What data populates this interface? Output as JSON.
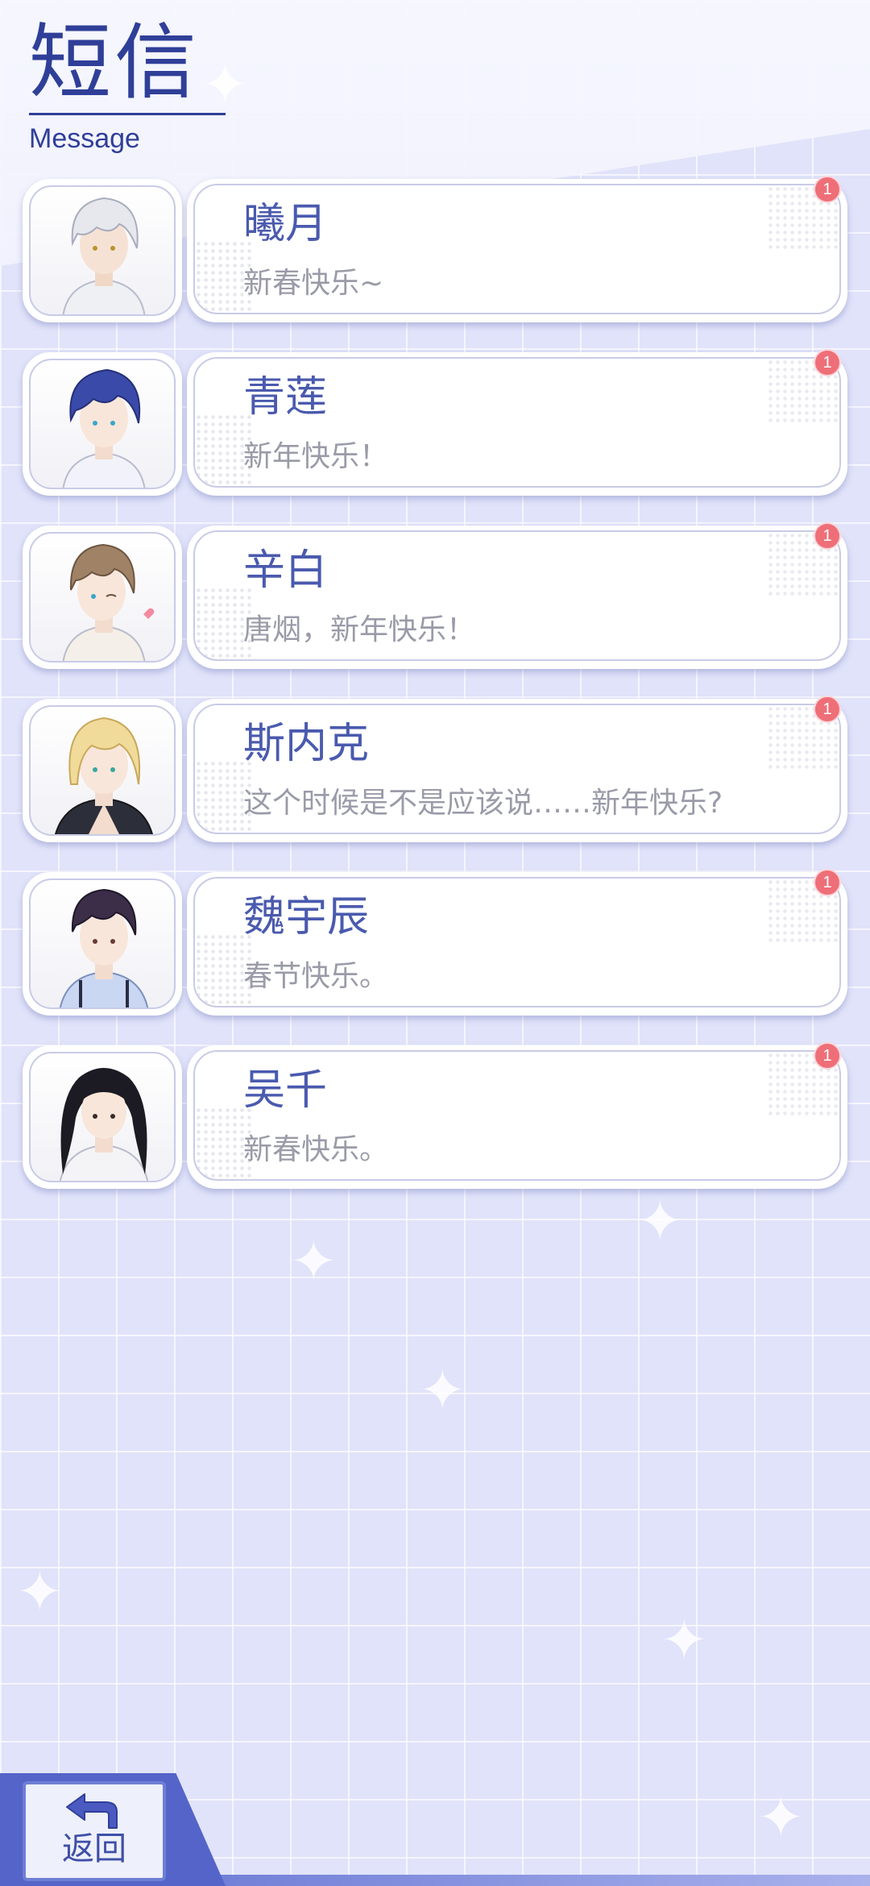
{
  "header": {
    "title": "短信",
    "subtitle": "Message"
  },
  "contacts": [
    {
      "name": "曦月",
      "message": "新春快乐~",
      "badge": "1",
      "avatar": "avatar-silver-hair"
    },
    {
      "name": "青莲",
      "message": "新年快乐！",
      "badge": "1",
      "avatar": "avatar-blue-hair"
    },
    {
      "name": "辛白",
      "message": "唐烟，新年快乐！",
      "badge": "1",
      "avatar": "avatar-brown-hair"
    },
    {
      "name": "斯内克",
      "message": "这个时候是不是应该说……新年快乐?",
      "badge": "1",
      "avatar": "avatar-blond-hair"
    },
    {
      "name": "魏宇辰",
      "message": "春节快乐。",
      "badge": "1",
      "avatar": "avatar-dark-hair"
    },
    {
      "name": "吴千",
      "message": "新春快乐。",
      "badge": "1",
      "avatar": "avatar-long-black-hair"
    }
  ],
  "footer": {
    "back_label": "返回",
    "back_icon": "back-arrow-icon"
  },
  "colors": {
    "accent": "#2f3f98",
    "name_text": "#4a5aae",
    "message_text": "#9a9ba8",
    "badge": "#ee6f78",
    "background": "#e1e3fa"
  }
}
